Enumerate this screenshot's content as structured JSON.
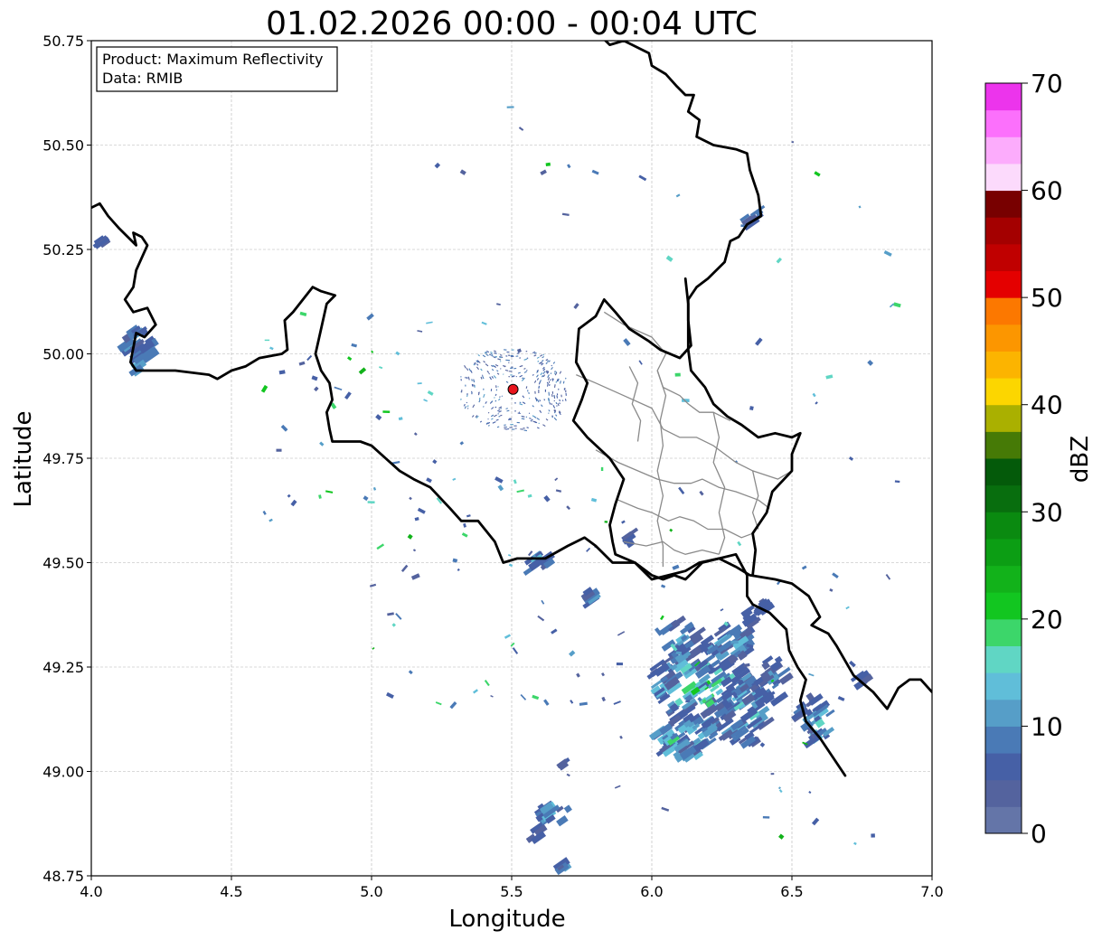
{
  "title": "01.02.2026 00:00 - 00:04 UTC",
  "xlabel": "Longitude",
  "ylabel": "Latitude",
  "info": {
    "line1": "Product: Maximum Reflectivity",
    "line2": "Data: RMIB"
  },
  "x_ticks": [
    "4.0",
    "4.5",
    "5.0",
    "5.5",
    "6.0",
    "6.5",
    "7.0"
  ],
  "y_ticks": [
    "48.75",
    "49.00",
    "49.25",
    "49.50",
    "49.75",
    "50.00",
    "50.25",
    "50.50",
    "50.75"
  ],
  "colorbar": {
    "label": "dBZ",
    "ticks": [
      "0",
      "10",
      "20",
      "30",
      "40",
      "50",
      "60",
      "70"
    ],
    "colors": [
      "#6475a8",
      "#54639e",
      "#4660a6",
      "#4a7ab6",
      "#569ec8",
      "#60bed9",
      "#60d6c4",
      "#3cd66a",
      "#12c620",
      "#12b21a",
      "#0c9e14",
      "#0a8a10",
      "#086e0e",
      "#045a0a",
      "#467a06",
      "#aab000",
      "#fcd600",
      "#fcb400",
      "#fc9600",
      "#fc7800",
      "#e40000",
      "#c00000",
      "#a40000",
      "#780000",
      "#fcdafc",
      "#fcacfc",
      "#fc70fc",
      "#ec34ec"
    ]
  },
  "chart_data": {
    "type": "heatmap",
    "xlim": [
      4.0,
      7.0
    ],
    "ylim": [
      48.75,
      50.75
    ],
    "grid": true,
    "radar_site": {
      "lon": 5.505,
      "lat": 49.915
    },
    "borders": [
      [
        [
          4.0,
          50.35
        ],
        [
          4.03,
          50.36
        ],
        [
          4.06,
          50.33
        ],
        [
          4.1,
          50.3
        ],
        [
          4.13,
          50.28
        ],
        [
          4.16,
          50.26
        ],
        [
          4.15,
          50.29
        ],
        [
          4.18,
          50.28
        ],
        [
          4.2,
          50.26
        ],
        [
          4.16,
          50.2
        ],
        [
          4.15,
          50.16
        ],
        [
          4.12,
          50.13
        ],
        [
          4.15,
          50.1
        ],
        [
          4.2,
          50.11
        ],
        [
          4.23,
          50.07
        ],
        [
          4.19,
          50.04
        ],
        [
          4.16,
          50.05
        ],
        [
          4.14,
          49.98
        ],
        [
          4.16,
          49.96
        ],
        [
          4.2,
          49.96
        ],
        [
          4.3,
          49.96
        ],
        [
          4.42,
          49.95
        ],
        [
          4.45,
          49.94
        ],
        [
          4.5,
          49.96
        ],
        [
          4.55,
          49.97
        ],
        [
          4.6,
          49.99
        ],
        [
          4.68,
          50.0
        ],
        [
          4.7,
          50.01
        ],
        [
          4.69,
          50.08
        ],
        [
          4.72,
          50.1
        ],
        [
          4.79,
          50.16
        ],
        [
          4.82,
          50.15
        ],
        [
          4.87,
          50.14
        ],
        [
          4.84,
          50.12
        ],
        [
          4.82,
          50.06
        ],
        [
          4.8,
          50.0
        ],
        [
          4.82,
          49.96
        ],
        [
          4.85,
          49.93
        ],
        [
          4.86,
          49.89
        ],
        [
          4.84,
          49.86
        ],
        [
          4.85,
          49.82
        ],
        [
          4.86,
          49.79
        ],
        [
          4.9,
          49.79
        ],
        [
          4.96,
          49.79
        ],
        [
          5.0,
          49.78
        ],
        [
          5.05,
          49.75
        ],
        [
          5.1,
          49.72
        ],
        [
          5.15,
          49.7
        ],
        [
          5.21,
          49.68
        ],
        [
          5.28,
          49.63
        ],
        [
          5.32,
          49.6
        ],
        [
          5.38,
          49.6
        ],
        [
          5.44,
          49.55
        ],
        [
          5.47,
          49.5
        ],
        [
          5.52,
          49.51
        ],
        [
          5.62,
          49.51
        ],
        [
          5.7,
          49.54
        ],
        [
          5.76,
          49.56
        ],
        [
          5.8,
          49.54
        ],
        [
          5.86,
          49.5
        ],
        [
          5.94,
          49.5
        ],
        [
          6.0,
          49.46
        ],
        [
          6.06,
          49.47
        ],
        [
          6.12,
          49.48
        ],
        [
          6.17,
          49.5
        ],
        [
          6.24,
          49.51
        ],
        [
          6.3,
          49.49
        ],
        [
          6.35,
          49.47
        ],
        [
          6.44,
          49.46
        ],
        [
          6.5,
          49.45
        ],
        [
          6.56,
          49.42
        ],
        [
          6.6,
          49.37
        ],
        [
          6.57,
          49.35
        ],
        [
          6.63,
          49.33
        ],
        [
          6.66,
          49.3
        ],
        [
          6.72,
          49.23
        ],
        [
          6.79,
          49.19
        ],
        [
          6.84,
          49.15
        ],
        [
          6.88,
          49.2
        ],
        [
          6.92,
          49.22
        ],
        [
          6.96,
          49.22
        ],
        [
          7.0,
          49.19
        ]
      ],
      [
        [
          5.82,
          50.76
        ],
        [
          5.85,
          50.74
        ],
        [
          5.9,
          50.75
        ],
        [
          5.96,
          50.73
        ],
        [
          5.99,
          50.72
        ],
        [
          6.0,
          50.69
        ],
        [
          6.05,
          50.67
        ],
        [
          6.09,
          50.64
        ],
        [
          6.12,
          50.62
        ],
        [
          6.15,
          50.62
        ],
        [
          6.13,
          50.58
        ],
        [
          6.17,
          50.56
        ],
        [
          6.16,
          50.52
        ],
        [
          6.22,
          50.5
        ],
        [
          6.3,
          50.49
        ],
        [
          6.34,
          50.48
        ],
        [
          6.35,
          50.44
        ],
        [
          6.38,
          50.38
        ],
        [
          6.39,
          50.33
        ],
        [
          6.34,
          50.31
        ],
        [
          6.31,
          50.28
        ],
        [
          6.28,
          50.27
        ],
        [
          6.26,
          50.22
        ],
        [
          6.2,
          50.18
        ],
        [
          6.16,
          50.16
        ],
        [
          6.13,
          50.13
        ],
        [
          6.13,
          50.08
        ],
        [
          6.14,
          50.02
        ],
        [
          6.1,
          49.99
        ],
        [
          6.03,
          50.01
        ],
        [
          5.99,
          50.03
        ],
        [
          5.92,
          50.06
        ],
        [
          5.87,
          50.1
        ],
        [
          5.83,
          50.13
        ],
        [
          5.8,
          50.09
        ],
        [
          5.74,
          50.06
        ],
        [
          5.73,
          49.98
        ],
        [
          5.77,
          49.93
        ],
        [
          5.75,
          49.89
        ],
        [
          5.72,
          49.84
        ],
        [
          5.77,
          49.8
        ],
        [
          5.85,
          49.75
        ],
        [
          5.9,
          49.7
        ],
        [
          5.87,
          49.64
        ],
        [
          5.85,
          49.59
        ],
        [
          5.86,
          49.55
        ],
        [
          5.87,
          49.52
        ],
        [
          5.94,
          49.5
        ],
        [
          6.0,
          49.47
        ],
        [
          6.04,
          49.46
        ],
        [
          6.08,
          49.47
        ],
        [
          6.12,
          49.46
        ],
        [
          6.18,
          49.5
        ],
        [
          6.24,
          49.51
        ],
        [
          6.3,
          49.52
        ],
        [
          6.34,
          49.47
        ],
        [
          6.34,
          49.42
        ],
        [
          6.36,
          49.4
        ],
        [
          6.42,
          49.38
        ],
        [
          6.48,
          49.34
        ],
        [
          6.49,
          49.29
        ],
        [
          6.52,
          49.25
        ],
        [
          6.55,
          49.22
        ],
        [
          6.53,
          49.17
        ],
        [
          6.55,
          49.12
        ],
        [
          6.6,
          49.08
        ],
        [
          6.65,
          49.03
        ],
        [
          6.69,
          48.99
        ]
      ],
      [
        [
          6.12,
          50.18
        ],
        [
          6.13,
          50.12
        ],
        [
          6.13,
          50.06
        ],
        [
          6.13,
          50.01
        ],
        [
          6.14,
          49.96
        ],
        [
          6.19,
          49.92
        ],
        [
          6.22,
          49.88
        ],
        [
          6.27,
          49.85
        ],
        [
          6.32,
          49.83
        ],
        [
          6.38,
          49.8
        ],
        [
          6.44,
          49.81
        ],
        [
          6.5,
          49.8
        ],
        [
          6.53,
          49.81
        ],
        [
          6.5,
          49.76
        ],
        [
          6.5,
          49.72
        ],
        [
          6.43,
          49.67
        ],
        [
          6.41,
          49.62
        ],
        [
          6.36,
          49.57
        ],
        [
          6.37,
          49.53
        ],
        [
          6.36,
          49.47
        ]
      ]
    ],
    "inner_borders": [
      [
        [
          5.83,
          50.1
        ],
        [
          5.9,
          50.07
        ],
        [
          6.0,
          50.04
        ],
        [
          6.05,
          50.0
        ],
        [
          6.02,
          49.96
        ],
        [
          6.04,
          49.92
        ],
        [
          6.1,
          49.9
        ],
        [
          6.13,
          49.88
        ],
        [
          6.17,
          49.86
        ],
        [
          6.22,
          49.86
        ],
        [
          6.28,
          49.84
        ]
      ],
      [
        [
          5.73,
          49.95
        ],
        [
          5.8,
          49.93
        ],
        [
          5.9,
          49.9
        ],
        [
          6.0,
          49.87
        ],
        [
          6.04,
          49.82
        ],
        [
          6.1,
          49.8
        ],
        [
          6.16,
          49.8
        ],
        [
          6.22,
          49.78
        ],
        [
          6.3,
          49.74
        ],
        [
          6.36,
          49.72
        ],
        [
          6.45,
          49.7
        ],
        [
          6.5,
          49.72
        ]
      ],
      [
        [
          5.8,
          49.77
        ],
        [
          5.88,
          49.74
        ],
        [
          5.95,
          49.72
        ],
        [
          6.02,
          49.7
        ],
        [
          6.08,
          49.69
        ],
        [
          6.14,
          49.69
        ],
        [
          6.18,
          49.7
        ],
        [
          6.24,
          49.68
        ],
        [
          6.3,
          49.67
        ],
        [
          6.38,
          49.65
        ],
        [
          6.42,
          49.63
        ]
      ],
      [
        [
          5.88,
          49.65
        ],
        [
          5.95,
          49.63
        ],
        [
          6.0,
          49.62
        ],
        [
          6.06,
          49.6
        ],
        [
          6.1,
          49.61
        ],
        [
          6.15,
          49.6
        ],
        [
          6.2,
          49.58
        ],
        [
          6.26,
          49.58
        ],
        [
          6.32,
          49.56
        ],
        [
          6.36,
          49.57
        ]
      ],
      [
        [
          5.9,
          49.55
        ],
        [
          5.98,
          49.54
        ],
        [
          6.04,
          49.55
        ],
        [
          6.08,
          49.53
        ],
        [
          6.12,
          49.52
        ],
        [
          6.18,
          49.53
        ],
        [
          6.24,
          49.52
        ]
      ],
      [
        [
          6.02,
          49.96
        ],
        [
          6.05,
          49.9
        ],
        [
          6.03,
          49.84
        ],
        [
          6.04,
          49.78
        ],
        [
          6.02,
          49.72
        ],
        [
          6.04,
          49.66
        ],
        [
          6.02,
          49.6
        ],
        [
          6.04,
          49.54
        ],
        [
          6.04,
          49.49
        ]
      ],
      [
        [
          6.22,
          49.86
        ],
        [
          6.24,
          49.8
        ],
        [
          6.22,
          49.74
        ],
        [
          6.26,
          49.68
        ],
        [
          6.24,
          49.62
        ],
        [
          6.26,
          49.56
        ],
        [
          6.24,
          49.52
        ]
      ],
      [
        [
          5.92,
          49.97
        ],
        [
          5.95,
          49.93
        ],
        [
          5.93,
          49.88
        ],
        [
          5.96,
          49.84
        ],
        [
          5.95,
          49.79
        ]
      ],
      [
        [
          6.36,
          49.72
        ],
        [
          6.38,
          49.66
        ],
        [
          6.36,
          49.62
        ],
        [
          6.38,
          49.58
        ]
      ]
    ],
    "echo_clusters": [
      {
        "lon": 6.17,
        "lat": 49.2,
        "r_lon": 0.18,
        "r_lat": 0.1,
        "n": 130,
        "dbz_min": 4,
        "dbz_max": 26
      },
      {
        "lon": 6.13,
        "lat": 49.08,
        "r_lon": 0.12,
        "r_lat": 0.05,
        "n": 60,
        "dbz_min": 4,
        "dbz_max": 26
      },
      {
        "lon": 6.33,
        "lat": 49.14,
        "r_lon": 0.09,
        "r_lat": 0.08,
        "n": 55,
        "dbz_min": 4,
        "dbz_max": 20
      },
      {
        "lon": 6.27,
        "lat": 49.3,
        "r_lon": 0.1,
        "r_lat": 0.05,
        "n": 45,
        "dbz_min": 4,
        "dbz_max": 18
      },
      {
        "lon": 6.1,
        "lat": 49.32,
        "r_lon": 0.07,
        "r_lat": 0.04,
        "n": 25,
        "dbz_min": 4,
        "dbz_max": 16
      },
      {
        "lon": 6.43,
        "lat": 49.22,
        "r_lon": 0.06,
        "r_lat": 0.06,
        "n": 25,
        "dbz_min": 4,
        "dbz_max": 14
      },
      {
        "lon": 6.58,
        "lat": 49.12,
        "r_lon": 0.06,
        "r_lat": 0.06,
        "n": 30,
        "dbz_min": 4,
        "dbz_max": 22
      },
      {
        "lon": 6.38,
        "lat": 49.38,
        "r_lon": 0.05,
        "r_lat": 0.03,
        "n": 15,
        "dbz_min": 4,
        "dbz_max": 10
      },
      {
        "lon": 4.17,
        "lat": 50.01,
        "r_lon": 0.05,
        "r_lat": 0.06,
        "n": 28,
        "dbz_min": 4,
        "dbz_max": 22
      },
      {
        "lon": 4.03,
        "lat": 50.26,
        "r_lon": 0.02,
        "r_lat": 0.02,
        "n": 5,
        "dbz_min": 4,
        "dbz_max": 8
      },
      {
        "lon": 5.65,
        "lat": 48.9,
        "r_lon": 0.06,
        "r_lat": 0.03,
        "n": 16,
        "dbz_min": 4,
        "dbz_max": 18
      },
      {
        "lon": 5.58,
        "lat": 48.85,
        "r_lon": 0.03,
        "r_lat": 0.02,
        "n": 7,
        "dbz_min": 4,
        "dbz_max": 10
      },
      {
        "lon": 5.69,
        "lat": 48.77,
        "r_lon": 0.02,
        "r_lat": 0.01,
        "n": 4,
        "dbz_min": 4,
        "dbz_max": 12
      },
      {
        "lon": 5.68,
        "lat": 49.02,
        "r_lon": 0.02,
        "r_lat": 0.01,
        "n": 3,
        "dbz_min": 4,
        "dbz_max": 12
      },
      {
        "lon": 6.36,
        "lat": 50.33,
        "r_lon": 0.03,
        "r_lat": 0.02,
        "n": 6,
        "dbz_min": 4,
        "dbz_max": 20
      },
      {
        "lon": 5.6,
        "lat": 49.5,
        "r_lon": 0.05,
        "r_lat": 0.02,
        "n": 10,
        "dbz_min": 4,
        "dbz_max": 22
      },
      {
        "lon": 5.78,
        "lat": 49.42,
        "r_lon": 0.04,
        "r_lat": 0.02,
        "n": 6,
        "dbz_min": 4,
        "dbz_max": 20
      },
      {
        "lon": 6.75,
        "lat": 49.22,
        "r_lon": 0.02,
        "r_lat": 0.03,
        "n": 5,
        "dbz_min": 4,
        "dbz_max": 10
      },
      {
        "lon": 5.93,
        "lat": 49.56,
        "r_lon": 0.02,
        "r_lat": 0.02,
        "n": 4,
        "dbz_min": 4,
        "dbz_max": 10
      }
    ],
    "echo_scatter": {
      "n": 190,
      "dbz_min": 4,
      "dbz_max": 24,
      "zones": [
        {
          "lon_min": 5.2,
          "lon_max": 6.9,
          "lat_min": 49.45,
          "lat_max": 50.6
        },
        {
          "lon_min": 5.0,
          "lon_max": 5.9,
          "lat_min": 49.15,
          "lat_max": 49.7
        },
        {
          "lon_min": 5.7,
          "lon_max": 6.8,
          "lat_min": 48.8,
          "lat_max": 49.5
        },
        {
          "lon_min": 4.6,
          "lon_max": 5.3,
          "lat_min": 49.6,
          "lat_max": 50.1
        }
      ]
    },
    "clutter_ring": {
      "lon": 5.505,
      "lat": 49.915,
      "r_lon": 0.2,
      "r_lat": 0.1,
      "n": 320
    }
  }
}
